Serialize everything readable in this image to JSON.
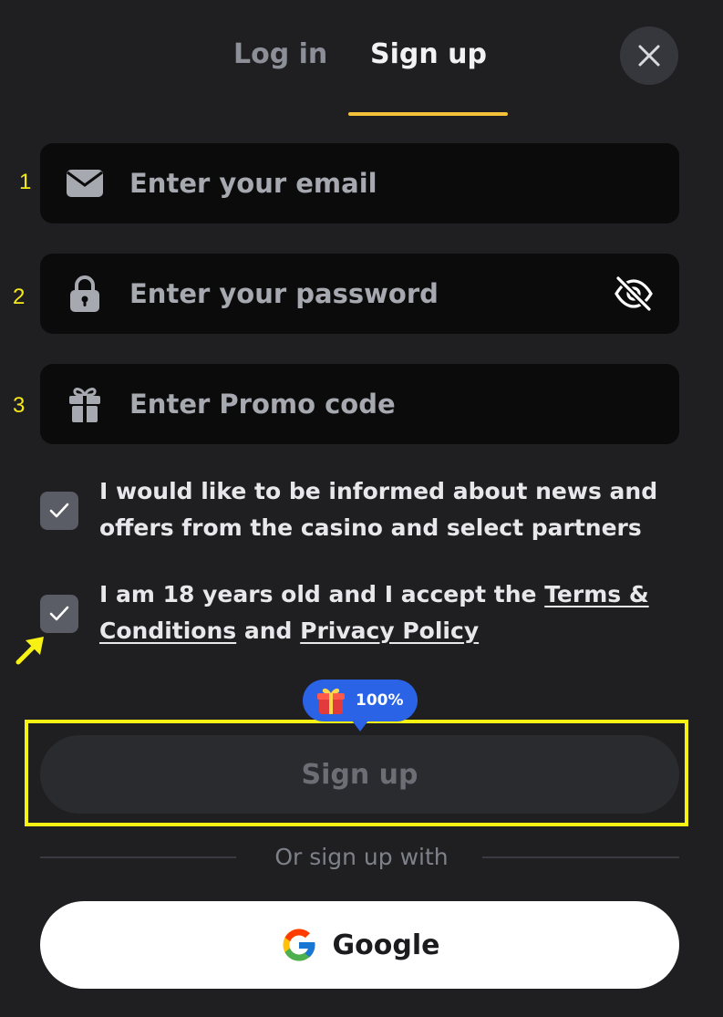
{
  "tabs": {
    "login_label": "Log in",
    "signup_label": "Sign up"
  },
  "annotations": {
    "field_1": "1",
    "field_2": "2",
    "field_3": "3"
  },
  "fields": {
    "email": {
      "placeholder": "Enter your email",
      "value": "",
      "icon": "envelope-icon"
    },
    "password": {
      "placeholder": "Enter your password",
      "value": "",
      "icon": "lock-icon",
      "toggle_icon": "eye-slash-icon"
    },
    "promo": {
      "placeholder": "Enter Promo code",
      "value": "",
      "icon": "gift-icon"
    }
  },
  "consents": {
    "news": {
      "checked": true,
      "text": "I would like to be informed about news and offers from the casino and select partners"
    },
    "age_terms": {
      "checked": true,
      "text_before": "I am 18 years old and I accept the ",
      "terms_link": "Terms & Conditions",
      "text_and": " and ",
      "privacy_link": "Privacy Policy"
    }
  },
  "bonus_badge": {
    "text": "100%",
    "icon": "gift-box-icon"
  },
  "signup_button": {
    "label": "Sign up"
  },
  "divider": {
    "text": "Or sign up with"
  },
  "google_button": {
    "label": "Google",
    "icon": "google-logo"
  },
  "colors": {
    "background": "#1f1f22",
    "field_background": "#0b0b0c",
    "accent_tab": "#f3c13a",
    "badge": "#2b63e7",
    "annotation": "#f5e81b"
  }
}
